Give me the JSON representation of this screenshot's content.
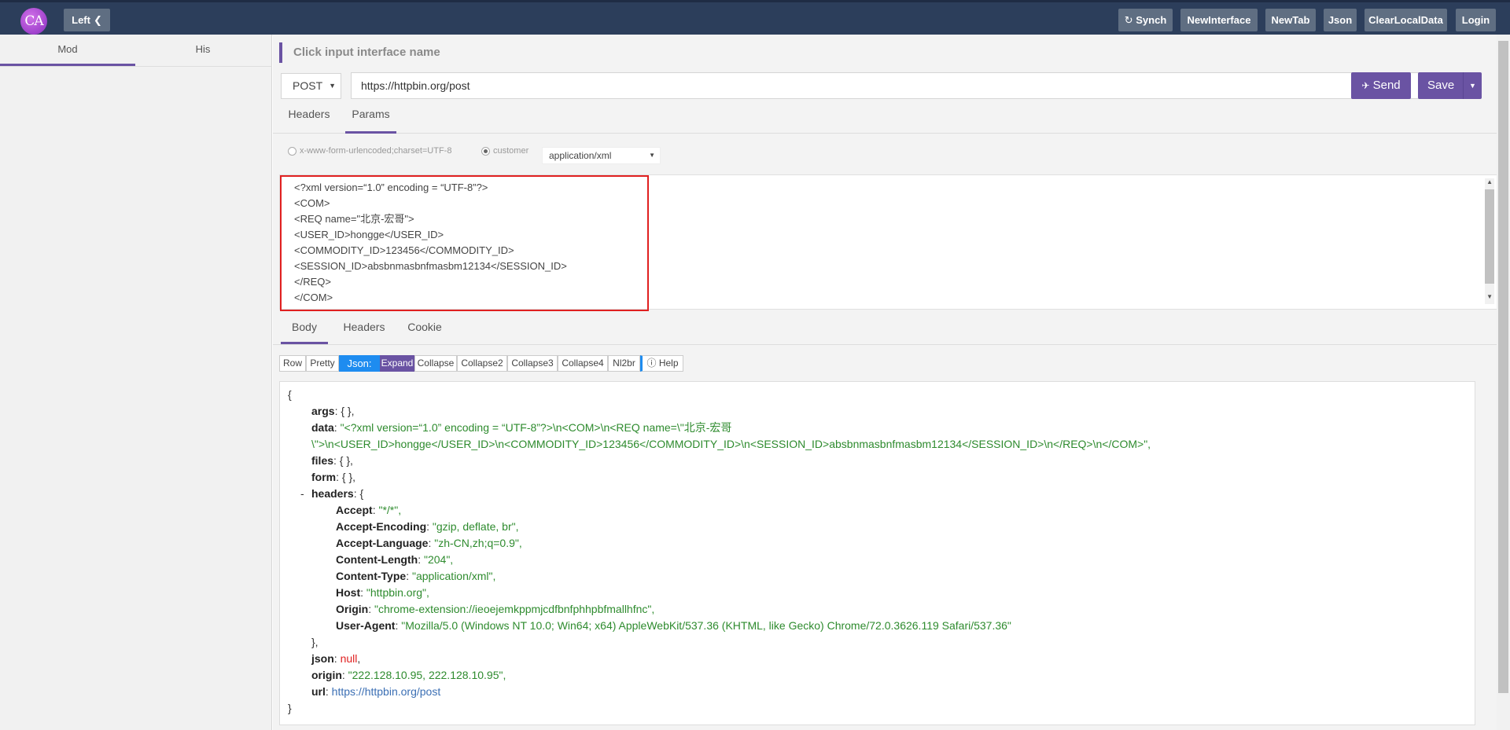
{
  "topbar": {
    "logo_text": "CA",
    "left_label": "Left",
    "right_buttons": [
      "Synch",
      "NewInterface",
      "NewTab",
      "Json",
      "ClearLocalData",
      "Login"
    ]
  },
  "sidebar": {
    "tabs": [
      "Mod",
      "His"
    ]
  },
  "request": {
    "name_placeholder": "Click input interface name",
    "method": "POST",
    "url": "https://httpbin.org/post",
    "send_label": "Send",
    "save_label": "Save",
    "tabs": [
      "Headers",
      "Params"
    ],
    "active_tab": "Params",
    "body_types": [
      "x-www-form-urlencoded;charset=UTF-8",
      "customer"
    ],
    "content_type": "application/xml",
    "xml_body": [
      "<?xml version=“1.0” encoding = “UTF-8”?>",
      "<COM>",
      "<REQ name=\"北京-宏哥\">",
      "<USER_ID>hongge</USER_ID>",
      "<COMMODITY_ID>123456</COMMODITY_ID>",
      "<SESSION_ID>absbnmasbnfmasbm12134</SESSION_ID>",
      "</REQ>",
      "</COM>"
    ]
  },
  "response": {
    "tabs": [
      "Body",
      "Headers",
      "Cookie"
    ],
    "active_tab": "Body",
    "toolbar": [
      "Row",
      "Pretty",
      "Json:",
      "Expand",
      "Collapse",
      "Collapse2",
      "Collapse3",
      "Collapse4",
      "Nl2br",
      "Help"
    ],
    "json": {
      "open": "{",
      "args": "{ },",
      "data_line1": "\"<?xml version=“1.0” encoding = “UTF-8”?>\\n<COM>\\n<REQ name=\\\"北京-宏哥",
      "data_line2": "\\\">\\n<USER_ID>hongge</USER_ID>\\n<COMMODITY_ID>123456</COMMODITY_ID>\\n<SESSION_ID>absbnmasbnfmasbm12134</SESSION_ID>\\n</REQ>\\n</COM>\",",
      "files": "{ },",
      "form": "{ },",
      "headers_open": "{",
      "collapse_marker": "-",
      "headers": [
        {
          "key": "Accept",
          "value": "\"*/*\","
        },
        {
          "key": "Accept-Encoding",
          "value": "\"gzip, deflate, br\","
        },
        {
          "key": "Accept-Language",
          "value": "\"zh-CN,zh;q=0.9\","
        },
        {
          "key": "Content-Length",
          "value": "\"204\","
        },
        {
          "key": "Content-Type",
          "value": "\"application/xml\","
        },
        {
          "key": "Host",
          "value": "\"httpbin.org\","
        },
        {
          "key": "Origin",
          "value": "\"chrome-extension://ieoejemkppmjcdfbnfphhpbfmallhfnc\","
        },
        {
          "key": "User-Agent",
          "value": "\"Mozilla/5.0 (Windows NT 10.0; Win64; x64) AppleWebKit/537.36 (KHTML, like Gecko) Chrome/72.0.3626.119 Safari/537.36\""
        }
      ],
      "headers_close": "},",
      "json_value": "null",
      "origin": "\"222.128.10.95, 222.128.10.95\",",
      "url": "https://httpbin.org/post",
      "close": "}"
    }
  }
}
